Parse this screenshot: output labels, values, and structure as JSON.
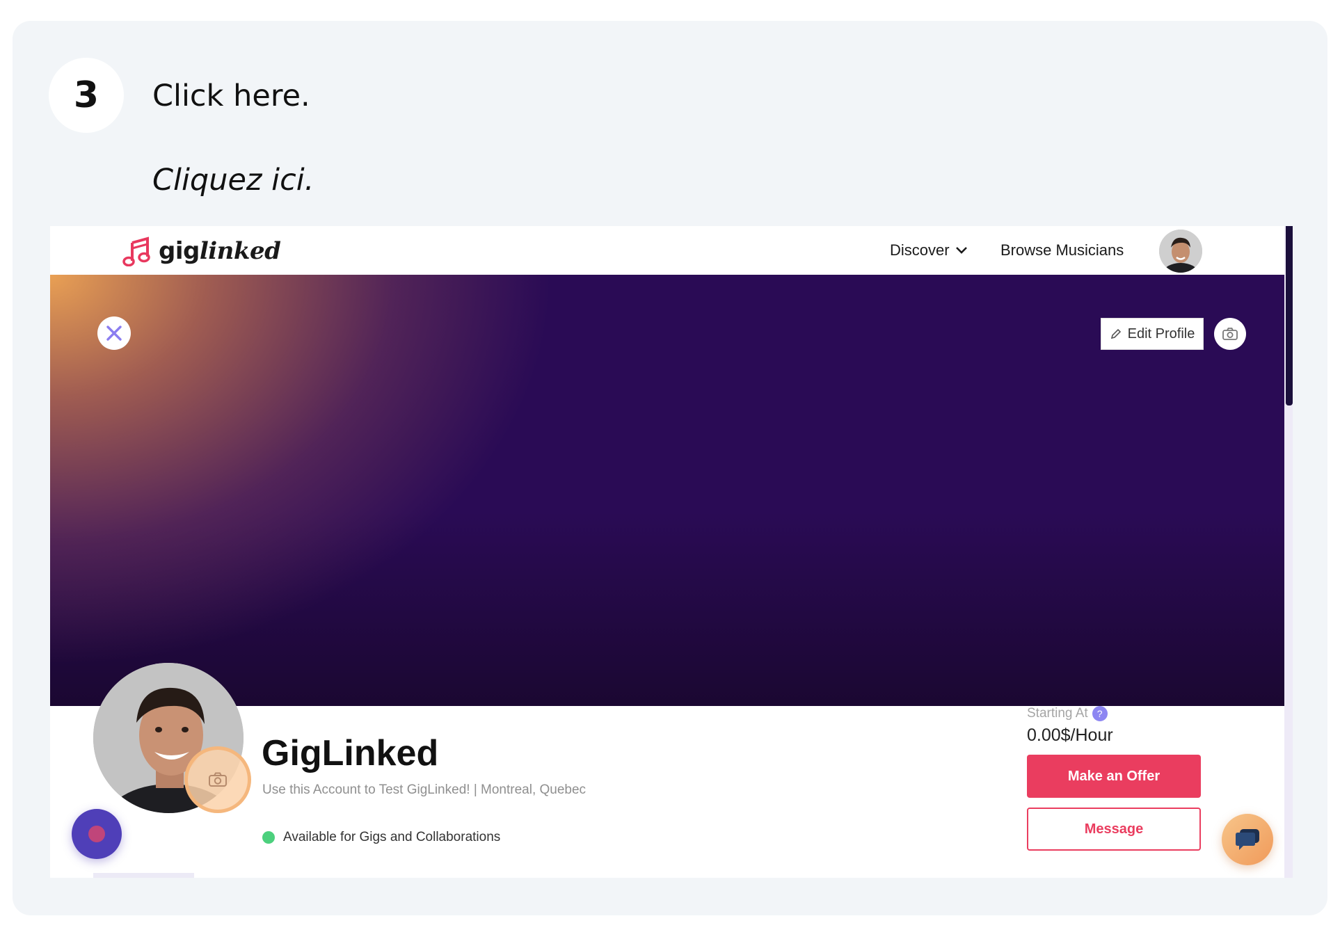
{
  "guide": {
    "step_number": "3",
    "instruction": "Click here.",
    "instruction_fr": "Cliquez ici."
  },
  "nav": {
    "logo_text_1": "gig",
    "logo_text_2": "linked",
    "discover": "Discover",
    "browse": "Browse Musicians"
  },
  "banner": {
    "edit_profile": "Edit Profile"
  },
  "profile": {
    "name": "GigLinked",
    "tagline": "Use this Account to Test GigLinked! | Montreal, Quebec",
    "availability": "Available for Gigs and Collaborations",
    "starting_at_label": "Starting At",
    "help_badge": "?",
    "price": "0.00$/Hour",
    "make_offer": "Make an Offer",
    "message": "Message"
  },
  "colors": {
    "brand_red": "#ea3d5f",
    "banner_dark": "#2a0b55",
    "banner_light": "#e9a054",
    "available_green": "#4cd07d"
  },
  "icons": [
    "music-note-logo-icon",
    "chevron-down-icon",
    "close-icon",
    "pencil-icon",
    "camera-icon",
    "help-icon",
    "record-icon",
    "chat-icon"
  ]
}
